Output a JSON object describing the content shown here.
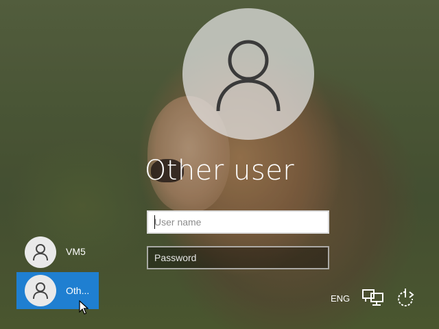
{
  "selected_user": {
    "name": "Other user"
  },
  "fields": {
    "username_placeholder": "User name",
    "password_placeholder": "Password"
  },
  "user_tiles": [
    {
      "label": "VM5",
      "selected": false
    },
    {
      "label": "Oth...",
      "selected": true
    }
  ],
  "system": {
    "language": "ENG",
    "network_icon": "network-icon",
    "power_icon": "power-icon"
  },
  "colors": {
    "accent": "#1f7fd1"
  }
}
